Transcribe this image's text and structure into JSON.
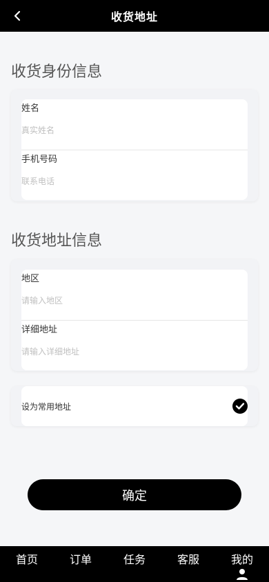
{
  "header": {
    "title": "收货地址",
    "back_icon": "chevron-left-icon"
  },
  "identity_section": {
    "title": "收货身份信息",
    "fields": [
      {
        "label": "姓名",
        "value": "",
        "placeholder": "真实姓名"
      },
      {
        "label": "手机号码",
        "value": "",
        "placeholder": "联系电话"
      }
    ]
  },
  "address_section": {
    "title": "收货地址信息",
    "fields": [
      {
        "label": "地区",
        "value": "",
        "placeholder": "请输入地区"
      },
      {
        "label": "详细地址",
        "value": "",
        "placeholder": "请输入详细地址"
      }
    ]
  },
  "default_option": {
    "label": "设为常用地址",
    "checked": true,
    "icon": "check-circle-icon"
  },
  "confirm_button": {
    "label": "确定"
  },
  "tabbar": {
    "items": [
      {
        "label": "首页"
      },
      {
        "label": "订单"
      },
      {
        "label": "任务"
      },
      {
        "label": "客服"
      },
      {
        "label": "我的",
        "icon": "user-icon"
      }
    ]
  },
  "colors": {
    "header_bg": "#000000",
    "page_bg": "#f5f6f8",
    "accent": "#000000",
    "placeholder": "#c0c0c0"
  }
}
